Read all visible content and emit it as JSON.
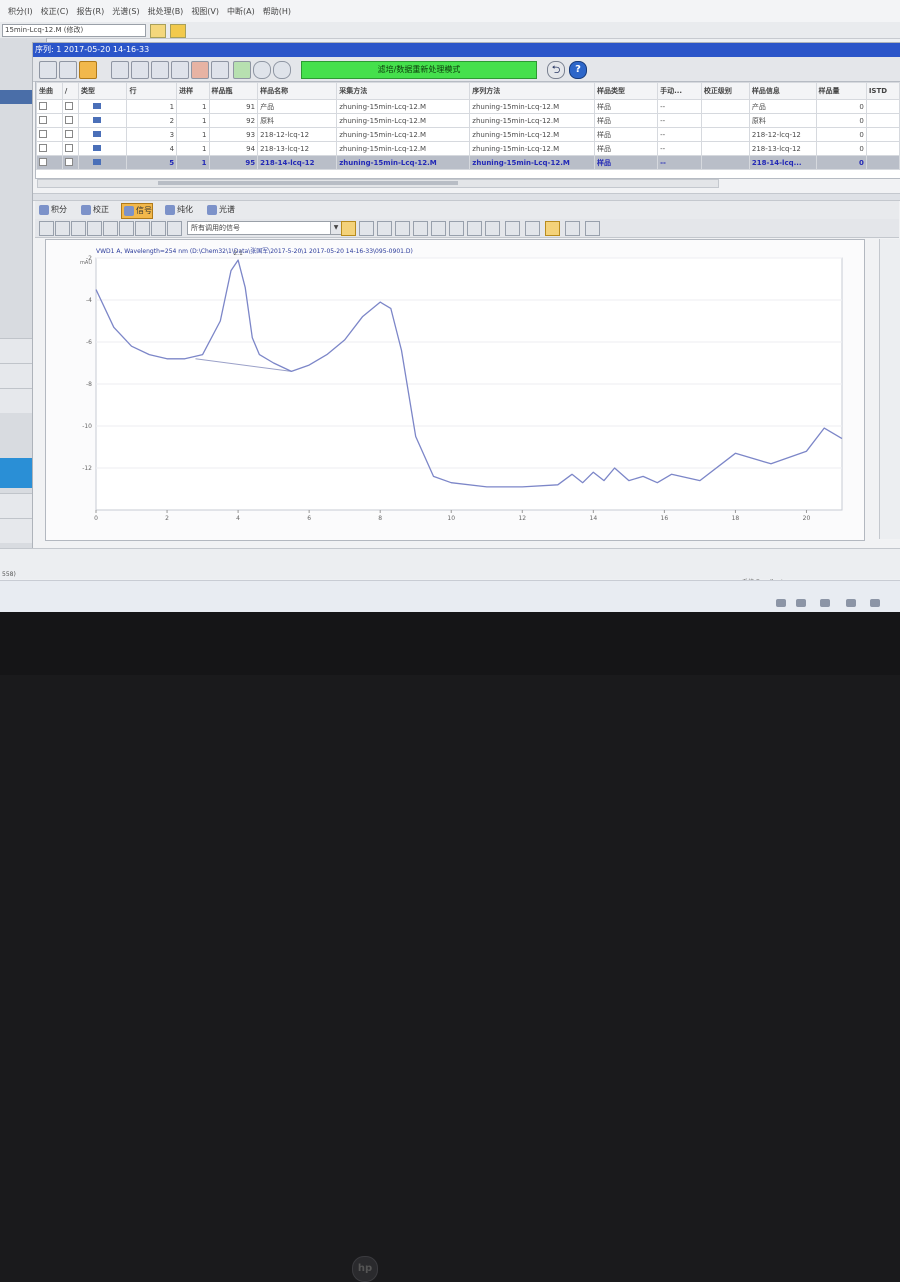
{
  "menubar": {
    "items": [
      "  积分(I)",
      "校正(C)",
      "报告(R)",
      "光谱(S)",
      "批处理(B)",
      "视图(V)",
      "中断(A)",
      "帮助(H)"
    ]
  },
  "toolbar1": {
    "method_combo": "15min-Lcq-12.M (修改)"
  },
  "window": {
    "title": "序列: 1 2017-05-20 14-16-33"
  },
  "toolbar2": {
    "mode_label": "滤培/数据重新处理模式",
    "help_label": "?",
    "arrow_label": "⮌"
  },
  "table": {
    "headers": [
      "坐曲",
      "/",
      "类型",
      "行",
      "进样",
      "样品瓶",
      "样品名称",
      "采集方法",
      "序列方法",
      "样品类型",
      "手动...",
      "校正级别",
      "样品信息",
      "样品量",
      "ISTD"
    ],
    "rows": [
      {
        "row": "1",
        "inj": "1",
        "vial": "91",
        "name": "产品",
        "acq": "zhuning-15min-Lcq-12.M",
        "seq": "zhuning-15min-Lcq-12.M",
        "type": "样品",
        "manual": "--",
        "cal": "",
        "info": "产品",
        "amt": "0"
      },
      {
        "row": "2",
        "inj": "1",
        "vial": "92",
        "name": "原料",
        "acq": "zhuning-15min-Lcq-12.M",
        "seq": "zhuning-15min-Lcq-12.M",
        "type": "样品",
        "manual": "--",
        "cal": "",
        "info": "原料",
        "amt": "0"
      },
      {
        "row": "3",
        "inj": "1",
        "vial": "93",
        "name": "218-12-lcq-12",
        "acq": "zhuning-15min-Lcq-12.M",
        "seq": "zhuning-15min-Lcq-12.M",
        "type": "样品",
        "manual": "--",
        "cal": "",
        "info": "218-12-lcq-12",
        "amt": "0"
      },
      {
        "row": "4",
        "inj": "1",
        "vial": "94",
        "name": "218-13-lcq-12",
        "acq": "zhuning-15min-Lcq-12.M",
        "seq": "zhuning-15min-Lcq-12.M",
        "type": "样品",
        "manual": "--",
        "cal": "",
        "info": "218-13-lcq-12",
        "amt": "0"
      },
      {
        "row": "5",
        "inj": "1",
        "vial": "95",
        "name": "218-14-lcq-12",
        "acq": "zhuning-15min-Lcq-12.M",
        "seq": "zhuning-15min-Lcq-12.M",
        "type": "样品",
        "manual": "--",
        "cal": "",
        "info": "218-14-lcq...",
        "amt": "0"
      }
    ]
  },
  "tabs": [
    "积分",
    "校正",
    "信号",
    "纯化",
    "光谱"
  ],
  "toolbar3": {
    "signal_combo": "所有调用的信号"
  },
  "chart_panel": {
    "signal_title": "VWD1 A, Wavelength=254 nm (D:\\Chem32\\1\\Data\\张国军\\2017-5-20\\1 2017-05-20 14-16-33\\095-0901.D)"
  },
  "chart_data": {
    "type": "line",
    "x": [
      0.0,
      0.5,
      1.0,
      1.5,
      2.0,
      2.5,
      3.0,
      3.5,
      3.8,
      4.0,
      4.2,
      4.4,
      4.6,
      5.0,
      5.5,
      6.0,
      6.5,
      7.0,
      7.5,
      8.0,
      8.3,
      8.6,
      9.0,
      9.5,
      10.0,
      11.0,
      12.0,
      13.0,
      13.4,
      13.7,
      14.0,
      14.3,
      14.6,
      15.0,
      15.4,
      15.8,
      16.2,
      17.0,
      18.0,
      19.0,
      20.0,
      20.5,
      21.0
    ],
    "y": [
      -3.5,
      -5.3,
      -6.2,
      -6.6,
      -6.8,
      -6.8,
      -6.6,
      -5.0,
      -2.6,
      -2.1,
      -3.4,
      -5.8,
      -6.6,
      -7.0,
      -7.4,
      -7.1,
      -6.6,
      -5.9,
      -4.8,
      -4.1,
      -4.4,
      -6.4,
      -10.5,
      -12.4,
      -12.7,
      -12.9,
      -12.9,
      -12.8,
      -12.3,
      -12.7,
      -12.2,
      -12.6,
      -12.0,
      -12.6,
      -12.4,
      -12.7,
      -12.3,
      -12.6,
      -11.3,
      -11.8,
      -11.2,
      -10.1,
      -10.6
    ],
    "xlim": [
      0,
      21
    ],
    "ylim": [
      -14,
      -2
    ],
    "x_ticks": [
      "0",
      "2",
      "4",
      "6",
      "8",
      "10",
      "12",
      "14",
      "16",
      "18",
      "20"
    ],
    "y_ticks": [
      "-2",
      "-4",
      "-6",
      "-8",
      "-10",
      "-12"
    ],
    "y_unit_label": "mAU",
    "peak_label": "2.1",
    "baseline": {
      "from": [
        2.8,
        -6.8
      ],
      "to": [
        5.5,
        -7.4
      ]
    },
    "grid": true,
    "line_color": "#7c86c8",
    "baseline_color": "#9aa0c8"
  },
  "statusbar": {
    "left_text": "558)",
    "right_text": "系统 Excellent"
  }
}
